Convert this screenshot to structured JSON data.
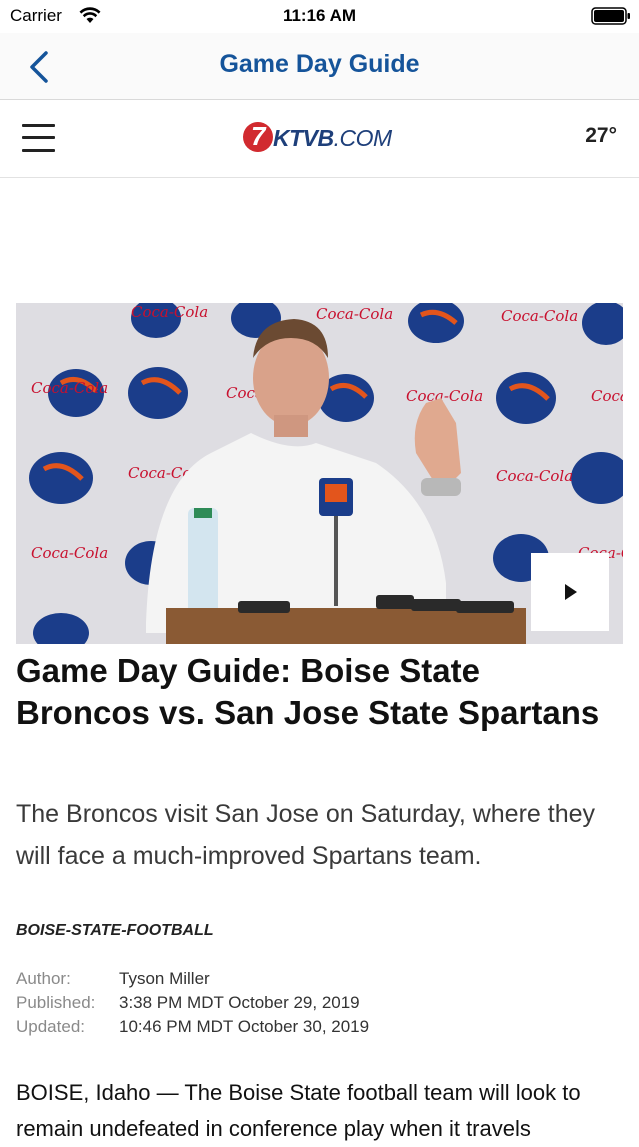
{
  "status_bar": {
    "carrier": "Carrier",
    "time": "11:16 AM",
    "wifi_icon": "wifi-icon",
    "battery_icon": "battery-icon"
  },
  "nav_bar": {
    "title": "Game Day Guide",
    "back_icon": "chevron-left-icon",
    "accent_color": "#15549a"
  },
  "site_header": {
    "menu_icon": "hamburger-menu-icon",
    "logo_numeral": "7",
    "logo_text": "KTVB",
    "logo_suffix": ".COM",
    "temperature": "27°"
  },
  "video": {
    "play_icon": "play-icon",
    "brand_colors": {
      "backdrop": "#dcdcdf",
      "bronco_blue": "#1b3d8a",
      "bronco_orange": "#e3551c",
      "sponsor_red": "#c8102e"
    }
  },
  "article": {
    "headline": "Game Day Guide: Boise State Broncos vs. San Jose State Spartans",
    "summary": "The Broncos visit San Jose on Saturday, where they will face a much-improved Spartans team.",
    "section": "BOISE-STATE-FOOTBALL",
    "meta": [
      {
        "label": "Author:",
        "value": "Tyson Miller"
      },
      {
        "label": "Published:",
        "value": "3:38 PM MDT October 29, 2019"
      },
      {
        "label": "Updated:",
        "value": "10:46 PM MDT October 30, 2019"
      }
    ],
    "body": "BOISE, Idaho — The Boise State football team will look to remain undefeated in conference play when it travels"
  }
}
